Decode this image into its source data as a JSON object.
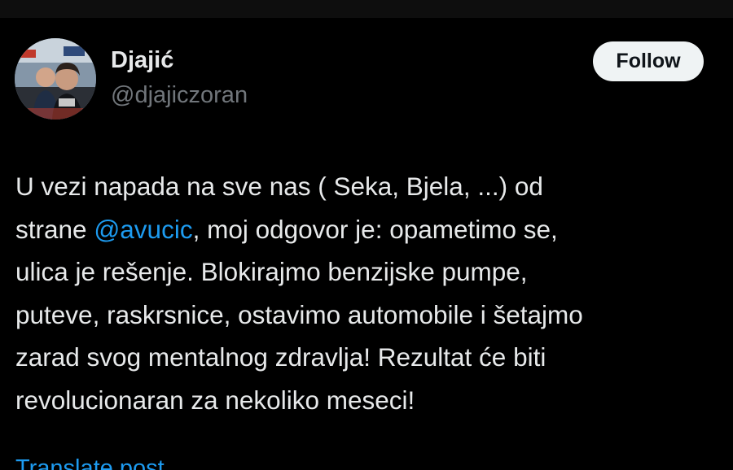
{
  "author": {
    "display_name": "Djajić",
    "handle": "@djajiczoran",
    "avatar_icon": "profile-photo"
  },
  "follow_button": {
    "label": "Follow"
  },
  "tweet": {
    "line1": "U vezi napada na sve nas ( Seka, Bjela, ...) od",
    "line2_before": "strane ",
    "mention": "@avucic",
    "line2_after": ", moj odgovor je: opametimo se,",
    "line3": "ulica je rešenje. Blokirajmo benzijske pumpe,",
    "line4": "puteve, raskrsnice, ostavimo automobile i šetajmo",
    "line5": "zarad svog mentalnog zdravlja! Rezultat će biti",
    "line6": "revolucionaran za nekoliko meseci!"
  },
  "translate_label": "Translate post",
  "colors": {
    "background": "#000000",
    "text": "#e7e9ea",
    "secondary_text": "#71767b",
    "link": "#1d9bf0",
    "follow_bg": "#eff3f4"
  }
}
